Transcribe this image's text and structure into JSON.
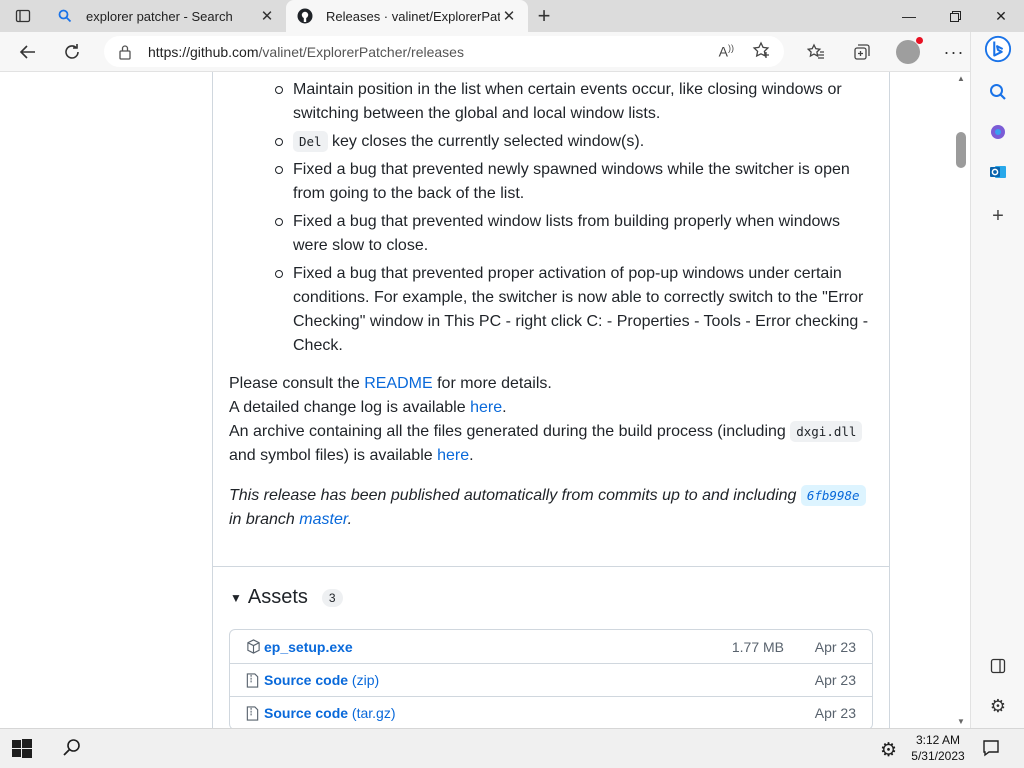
{
  "tabs": [
    {
      "title": "explorer patcher - Search",
      "icon": "search-icon",
      "active": false
    },
    {
      "title": "Releases · valinet/ExplorerPatcher",
      "icon": "github-icon",
      "active": true
    }
  ],
  "address": {
    "url_host": "https://github.com",
    "url_path": "/valinet/ExplorerPatcher/releases"
  },
  "content": {
    "bullets": [
      "Maintain position in the list when certain events occur, like closing windows or switching between the global and local window lists.",
      "key closes the currently selected window(s).",
      "Fixed a bug that prevented newly spawned windows while the switcher is open from going to the back of the list.",
      "Fixed a bug that prevented window lists from building properly when windows were slow to close.",
      "Fixed a bug that prevented proper activation of pop-up windows under certain conditions. For example, the switcher is now able to correctly switch to the \"Error Checking\" window in This PC - right click C: - Properties - Tools - Error checking - Check."
    ],
    "del_code": "Del",
    "readme_pre": "Please consult the ",
    "readme_link": "README",
    "readme_post": " for more details.",
    "changelog_pre": "A detailed change log is available ",
    "changelog_link": "here",
    "changelog_post": ".",
    "archive_pre": "An archive containing all the files generated during the build process (including ",
    "archive_code": "dxgi.dll",
    "archive_mid": " and symbol files) is available ",
    "archive_link": "here",
    "archive_post": ".",
    "published_pre": "This release has been published automatically from commits up to and including ",
    "published_commit": "6fb998e",
    "published_mid": " in branch ",
    "published_branch": "master",
    "published_post": "."
  },
  "assets": {
    "title": "Assets",
    "count": "3",
    "items": [
      {
        "name": "ep_setup.exe",
        "sub": "",
        "size": "1.77 MB",
        "date": "Apr 23",
        "icon": "package-icon"
      },
      {
        "name": "Source code",
        "sub": "(zip)",
        "size": "",
        "date": "Apr 23",
        "icon": "file-zip-icon"
      },
      {
        "name": "Source code",
        "sub": "(tar.gz)",
        "size": "",
        "date": "Apr 23",
        "icon": "file-zip-icon"
      }
    ]
  },
  "taskbar": {
    "time": "3:12 AM",
    "date": "5/31/2023"
  },
  "colors": {
    "link": "#0969da",
    "bing": "#1a73e8"
  }
}
